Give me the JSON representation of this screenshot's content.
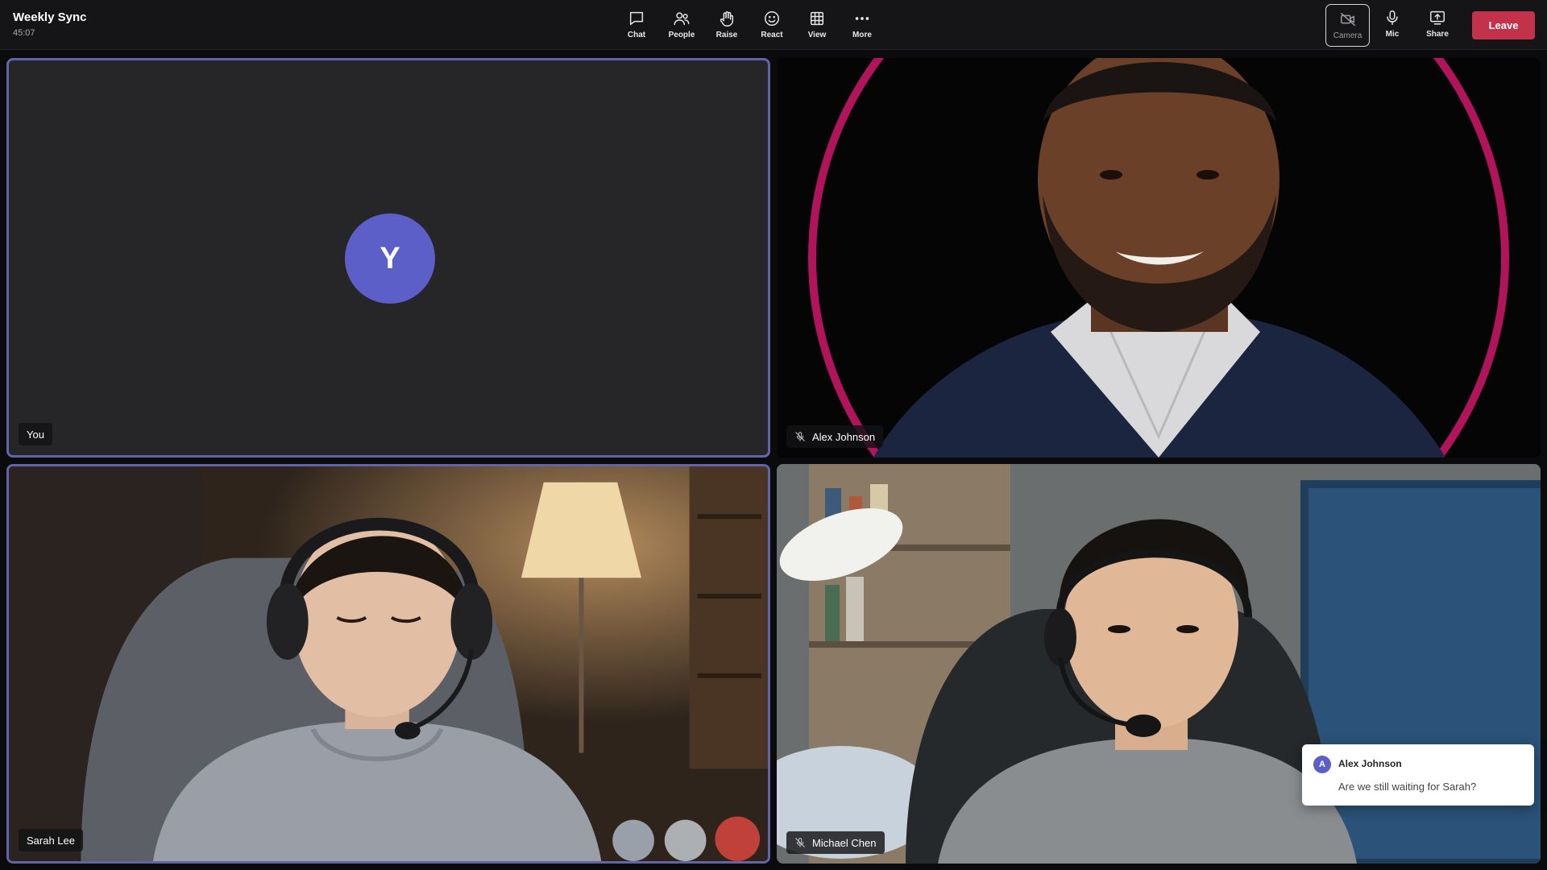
{
  "meeting": {
    "title": "Weekly Sync",
    "timer": "45:07"
  },
  "toolbar": {
    "chat_label": "Chat",
    "people_label": "People",
    "raise_label": "Raise",
    "react_label": "React",
    "view_label": "View",
    "more_label": "More",
    "camera_label": "Camera",
    "mic_label": "Mic",
    "share_label": "Share",
    "leave_label": "Leave"
  },
  "participants": {
    "you": {
      "name": "You",
      "initial": "Y",
      "camera": "off",
      "avatar_color": "#5b5fc7"
    },
    "alex": {
      "name": "Alex Johnson",
      "muted": true,
      "ring_color": "#b0145a"
    },
    "sarah": {
      "name": "Sarah Lee"
    },
    "michael": {
      "name": "Michael Chen",
      "muted": true
    }
  },
  "chat_toast": {
    "initial": "A",
    "sender": "Alex Johnson",
    "message": "Are we still waiting for Sarah?"
  },
  "colors": {
    "accent": "#6264a7",
    "leave": "#c4314b",
    "topbar": "#151517"
  }
}
